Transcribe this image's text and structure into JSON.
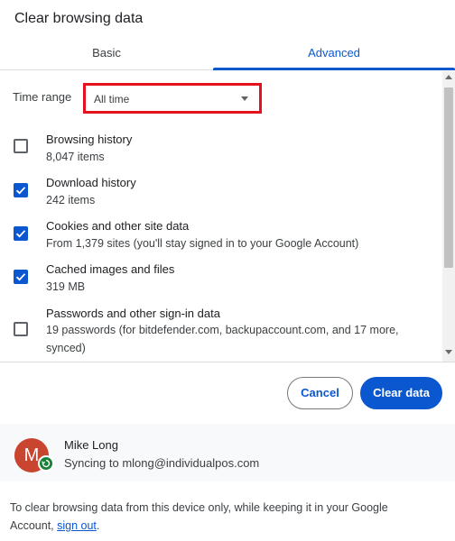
{
  "dialog": {
    "title": "Clear browsing data"
  },
  "tabs": [
    {
      "label": "Basic"
    },
    {
      "label": "Advanced"
    }
  ],
  "time_range": {
    "label": "Time range",
    "value": "All time"
  },
  "items": [
    {
      "title": "Browsing history",
      "desc": "8,047 items",
      "checked": false
    },
    {
      "title": "Download history",
      "desc": "242 items",
      "checked": true
    },
    {
      "title": "Cookies and other site data",
      "desc": "From 1,379 sites (you'll stay signed in to your Google Account)",
      "checked": true
    },
    {
      "title": "Cached images and files",
      "desc": "319 MB",
      "checked": true
    },
    {
      "title": "Passwords and other sign-in data",
      "desc": "19 passwords (for bitdefender.com, backupaccount.com, and 17 more, synced)",
      "checked": false
    }
  ],
  "buttons": {
    "cancel": "Cancel",
    "clear": "Clear data"
  },
  "account": {
    "initial": "M",
    "name": "Mike Long",
    "sync": "Syncing to mlong@individualpos.com"
  },
  "footer": {
    "text_before": "To clear browsing data from this device only, while keeping it in your Google Account,",
    "link": "sign out",
    "text_after": "."
  },
  "colors": {
    "accent": "#0b57d0",
    "highlight_border": "#e3121e",
    "avatar": "#c9452f",
    "sync": "#188038"
  }
}
